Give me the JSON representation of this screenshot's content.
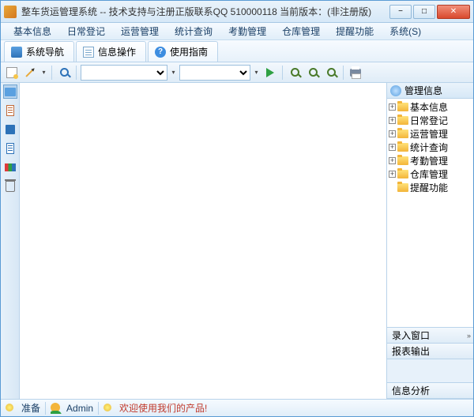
{
  "title": "整车货运管理系统 -- 技术支持与注册正版联系QQ 510000118   当前版本：(非注册版)",
  "menu": {
    "m0": "基本信息",
    "m1": "日常登记",
    "m2": "运营管理",
    "m3": "统计查询",
    "m4": "考勤管理",
    "m5": "仓库管理",
    "m6": "提醒功能",
    "m7": "系统(S)"
  },
  "tabs": {
    "t0": "系统导航",
    "t1": "信息操作",
    "t2": "使用指南",
    "help_glyph": "?"
  },
  "right": {
    "header": "管理信息",
    "n0": "基本信息",
    "n1": "日常登记",
    "n2": "运营管理",
    "n3": "统计查询",
    "n4": "考勤管理",
    "n5": "仓库管理",
    "n6": "提醒功能",
    "b0": "录入窗口",
    "b1": "报表输出",
    "b2": "信息分析"
  },
  "status": {
    "ready": "准备",
    "user": "Admin",
    "welcome": "欢迎使用我们的产品!"
  },
  "glyphs": {
    "plus": "+",
    "min": "−",
    "max": "□",
    "close": "✕",
    "dd": "▾",
    "exp": "»"
  }
}
